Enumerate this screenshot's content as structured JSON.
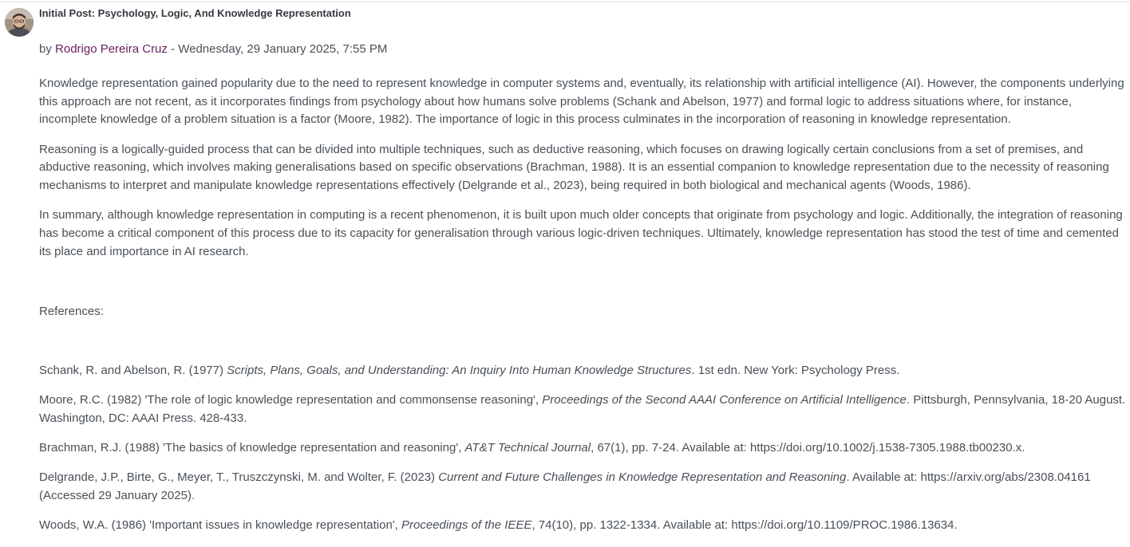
{
  "post": {
    "title": "Initial Post: Psychology, Logic, And Knowledge Representation",
    "by_prefix": "by ",
    "author": "Rodrigo Pereira Cruz",
    "date_text": " - Wednesday, 29 January 2025, 7:55 PM",
    "paragraphs": [
      "Knowledge representation gained popularity due to the need to represent knowledge in computer systems and, eventually, its relationship with artificial intelligence (AI). However, the components underlying this approach are not recent, as it incorporates findings from psychology about how humans solve problems (Schank and Abelson, 1977) and formal logic to address situations where, for instance, incomplete knowledge of a problem situation is a factor (Moore, 1982). The importance of logic in this process culminates in the incorporation of reasoning in knowledge representation.",
      "Reasoning is a logically-guided process that can be divided into multiple techniques, such as deductive reasoning, which focuses on drawing logically certain conclusions from a set of premises, and abductive reasoning, which involves making generalisations based on specific observations (Brachman, 1988). It is an essential companion to knowledge representation due to the necessity of reasoning mechanisms to interpret and manipulate knowledge representations effectively (Delgrande et al., 2023), being required in both biological and mechanical agents (Woods, 1986).",
      "In summary, although knowledge representation in computing is a recent phenomenon, it is built upon much older concepts that originate from psychology and logic. Additionally, the integration of reasoning has become a critical component of this process due to its capacity for generalisation through various logic-driven techniques. Ultimately, knowledge representation has stood the test of time and cemented its place and importance in AI research."
    ],
    "references_label": "References:",
    "references": [
      {
        "pre": "Schank, R. and Abelson, R. (1977) ",
        "italic": "Scripts, Plans, Goals, and Understanding: An Inquiry Into Human Knowledge Structures",
        "post": ". 1st edn. New York: Psychology Press."
      },
      {
        "pre": "Moore, R.C. (1982) 'The role of logic knowledge representation and commonsense reasoning', ",
        "italic": "Proceedings of the Second AAAI Conference on Artificial Intelligence",
        "post": ". Pittsburgh, Pennsylvania, 18-20 August. Washington, DC: AAAI Press. 428-433."
      },
      {
        "pre": "Brachman, R.J. (1988) 'The basics of knowledge representation and reasoning', ",
        "italic": "AT&T Technical Journal",
        "post": ", 67(1), pp. 7-24. Available at: https://doi.org/10.1002/j.1538-7305.1988.tb00230.x."
      },
      {
        "pre": "Delgrande, J.P., Birte, G., Meyer, T., Truszczynski, M. and Wolter, F. (2023) ",
        "italic": "Current and Future Challenges in Knowledge Representation and Reasoning",
        "post": ". Available at: https://arxiv.org/abs/2308.04161 (Accessed 29 January 2025)."
      },
      {
        "pre": "Woods, W.A. (1986) 'Important issues in knowledge representation', ",
        "italic": "Proceedings of the IEEE",
        "post": ", 74(10), pp. 1322-1334. Available at: https://doi.org/10.1109/PROC.1986.13634."
      }
    ]
  }
}
